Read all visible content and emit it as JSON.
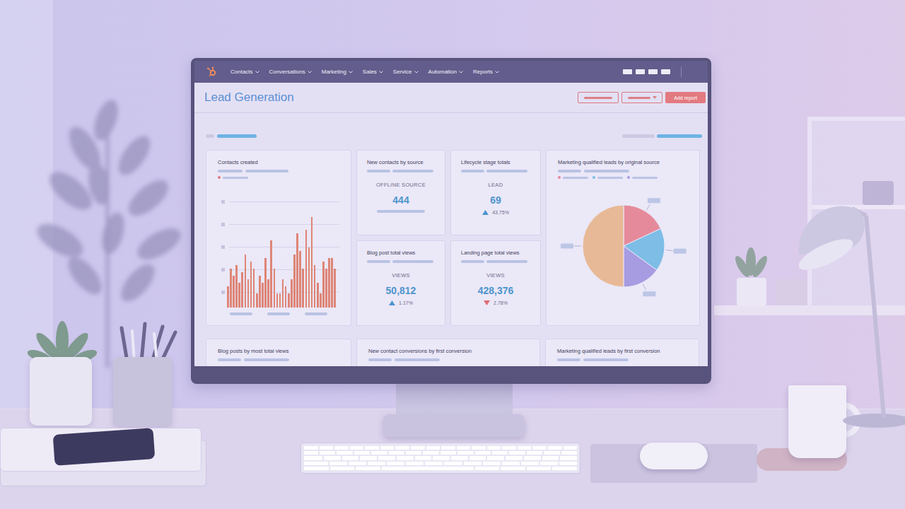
{
  "nav": {
    "items": [
      {
        "label": "Contacts"
      },
      {
        "label": "Conversations"
      },
      {
        "label": "Marketing"
      },
      {
        "label": "Sales"
      },
      {
        "label": "Service"
      },
      {
        "label": "Automation"
      },
      {
        "label": "Reports"
      }
    ]
  },
  "dashboard": {
    "title": "Lead Generation",
    "add_report": "Add report"
  },
  "contacts_created": {
    "title": "Contacts created",
    "values": [
      30,
      55,
      45,
      60,
      35,
      50,
      75,
      40,
      65,
      55,
      20,
      45,
      35,
      70,
      40,
      95,
      55,
      20,
      20,
      40,
      30,
      20,
      40,
      75,
      105,
      80,
      55,
      110,
      85,
      128,
      60,
      35,
      20,
      65,
      55,
      70,
      70,
      55
    ]
  },
  "metrics": [
    {
      "title": "New contacts by source",
      "label": "OFFLINE SOURCE",
      "value": "444",
      "kind": "bar"
    },
    {
      "title": "Lifecycle stage totals",
      "label": "LEAD",
      "value": "69",
      "change": "43.75%",
      "kind": "up"
    },
    {
      "title": "Blog post total views",
      "label": "VIEWS",
      "value": "50,812",
      "change": "1.17%",
      "kind": "up"
    },
    {
      "title": "Landing page total views",
      "label": "VIEWS",
      "value": "428,376",
      "change": "2.78%",
      "kind": "down"
    }
  ],
  "mql_by_source": {
    "title": "Marketing qualified leads by original source",
    "slices": [
      {
        "value": 18,
        "color": "#e58a9b",
        "legend": true
      },
      {
        "value": 17,
        "color": "#7dbde6",
        "legend": true
      },
      {
        "value": 15,
        "color": "#a79be2",
        "legend": true
      },
      {
        "value": 50,
        "color": "#e8b996",
        "legend": false
      }
    ]
  },
  "bottom_cards": [
    {
      "title": "Blog posts by most total views"
    },
    {
      "title": "New contact conversions by first conversion"
    },
    {
      "title": "Marketing qualified leads by first conversion"
    }
  ]
}
